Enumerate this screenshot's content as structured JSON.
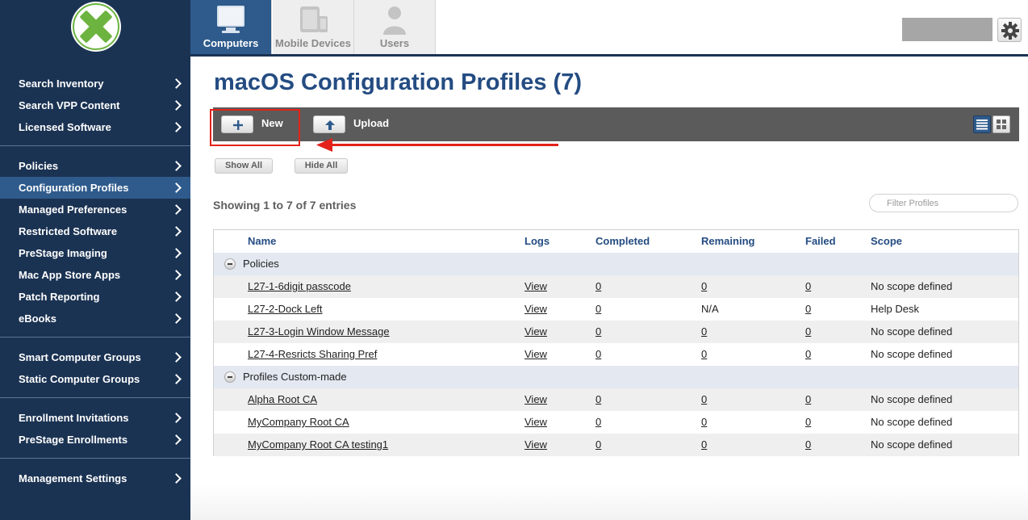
{
  "sidebar": {
    "groups": [
      [
        "Search Inventory",
        "Search VPP Content",
        "Licensed Software"
      ],
      [
        "Policies",
        "Configuration Profiles",
        "Managed Preferences",
        "Restricted Software",
        "PreStage Imaging",
        "Mac App Store Apps",
        "Patch Reporting",
        "eBooks"
      ],
      [
        "Smart Computer Groups",
        "Static Computer Groups"
      ],
      [
        "Enrollment Invitations",
        "PreStage Enrollments"
      ],
      [
        "Management Settings"
      ]
    ],
    "active_item": "Configuration Profiles"
  },
  "top_tabs": [
    {
      "label": "Computers",
      "icon": "computer-icon",
      "active": true
    },
    {
      "label": "Mobile Devices",
      "icon": "mobile-devices-icon",
      "active": false
    },
    {
      "label": "Users",
      "icon": "user-icon",
      "active": false
    }
  ],
  "header": {
    "page_title": "macOS Configuration Profiles (7)"
  },
  "toolbar": {
    "new_label": "New",
    "upload_label": "Upload"
  },
  "controls": {
    "show_all": "Show All",
    "hide_all": "Hide All"
  },
  "showing_text": "Showing 1 to 7 of 7 entries",
  "filter": {
    "placeholder": "Filter Profiles",
    "value": ""
  },
  "table": {
    "columns": [
      "Name",
      "Logs",
      "Completed",
      "Remaining",
      "Failed",
      "Scope"
    ],
    "groups": [
      {
        "name": "Policies",
        "rows": [
          {
            "name": "L27-1-6digit passcode",
            "logs": "View",
            "completed": "0",
            "remaining": "0",
            "failed": "0",
            "scope": "No scope defined"
          },
          {
            "name": "L27-2-Dock Left",
            "logs": "View",
            "completed": "0",
            "remaining": "N/A",
            "failed": "0",
            "scope": "Help Desk"
          },
          {
            "name": "L27-3-Login Window Message",
            "logs": "View",
            "completed": "0",
            "remaining": "0",
            "failed": "0",
            "scope": "No scope defined"
          },
          {
            "name": "L27-4-Resricts Sharing Pref",
            "logs": "View",
            "completed": "0",
            "remaining": "0",
            "failed": "0",
            "scope": "No scope defined"
          }
        ]
      },
      {
        "name": "Profiles Custom-made",
        "rows": [
          {
            "name": "Alpha Root CA",
            "logs": "View",
            "completed": "0",
            "remaining": "0",
            "failed": "0",
            "scope": "No scope defined"
          },
          {
            "name": "MyCompany Root CA",
            "logs": "View",
            "completed": "0",
            "remaining": "0",
            "failed": "0",
            "scope": "No scope defined"
          },
          {
            "name": "MyCompany Root CA testing1",
            "logs": "View",
            "completed": "0",
            "remaining": "0",
            "failed": "0",
            "scope": "No scope defined"
          }
        ]
      }
    ]
  },
  "colors": {
    "sidebar_bg": "#1b3353",
    "accent": "#2f5b8c",
    "title": "#244c82",
    "annotation_red": "#e32219"
  }
}
